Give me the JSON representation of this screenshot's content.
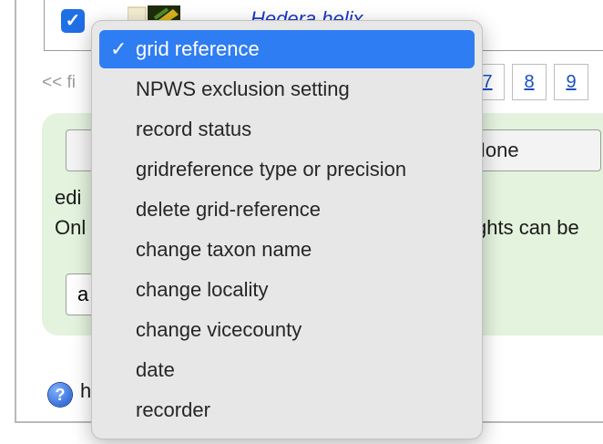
{
  "taxon_link": "Hedera helix",
  "pager": {
    "first": "<< fi",
    "pages": [
      "7",
      "8",
      "9"
    ]
  },
  "panel": {
    "none_button": "None",
    "edit_text": "edi",
    "only_text": "Onl",
    "rights_text": "ghts can be",
    "select_value": "a"
  },
  "help_text": "h",
  "dropdown": {
    "items": [
      "grid reference",
      "NPWS exclusion setting",
      "record status",
      "gridreference type or precision",
      "delete grid-reference",
      "change taxon name",
      "change locality",
      "change vicecounty",
      "date",
      "recorder"
    ],
    "selected_index": 0,
    "check_glyph": "✓"
  },
  "colors": {
    "accent": "#2f7df2",
    "panel_bg": "#e3f3de",
    "link": "#1a4fbf"
  }
}
